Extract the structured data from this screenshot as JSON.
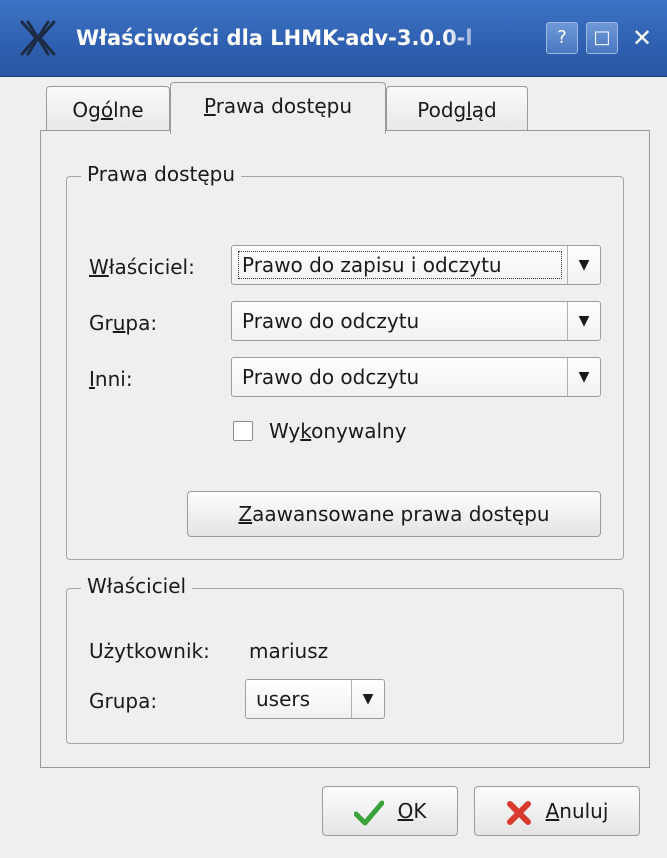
{
  "window": {
    "title": "Właściwości dla LHMK-adv-3.0.0-l",
    "help_glyph": "?",
    "maximize_glyph": "□",
    "close_glyph": "✕"
  },
  "tabs": [
    {
      "pre": "Og",
      "u": "ó",
      "post": "lne"
    },
    {
      "pre": "",
      "u": "P",
      "post": "rawa dostępu"
    },
    {
      "pre": "Podg",
      "u": "l",
      "post": "ąd"
    }
  ],
  "permissions": {
    "group_title": "Prawa dostępu",
    "owner_label": {
      "pre": "",
      "u": "W",
      "post": "łaściciel:"
    },
    "owner_value": "Prawo do zapisu i odczytu",
    "group_label": {
      "pre": "Gr",
      "u": "u",
      "post": "pa:"
    },
    "group_value": "Prawo do odczytu",
    "others_label": {
      "pre": "",
      "u": "I",
      "post": "nni:"
    },
    "others_value": "Prawo do odczytu",
    "executable_label": {
      "pre": "Wy",
      "u": "k",
      "post": "onywalny"
    },
    "executable_checked": false,
    "advanced_button": {
      "pre": "",
      "u": "Z",
      "post": "aawansowane prawa dostępu"
    }
  },
  "ownership": {
    "group_title": "Właściciel",
    "user_label": "Użytkownik:",
    "user_value": "mariusz",
    "group_label": "Grupa:",
    "group_value": "users"
  },
  "buttons": {
    "ok": {
      "pre": "",
      "u": "O",
      "post": "K"
    },
    "cancel": {
      "pre": "",
      "u": "A",
      "post": "nuluj"
    }
  },
  "dropdown_arrow": "▼"
}
